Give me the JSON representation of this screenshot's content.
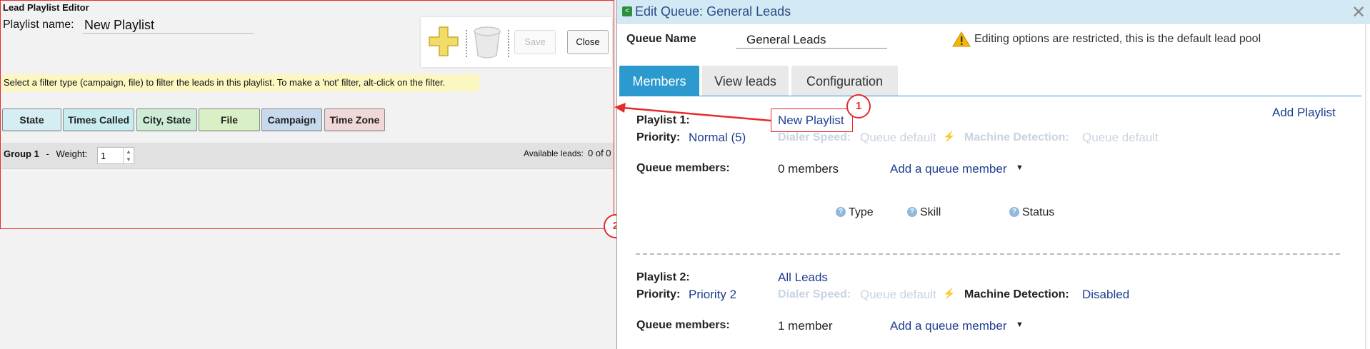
{
  "left_panel": {
    "title": "Lead Playlist Editor",
    "playlist_name_label": "Playlist name:",
    "playlist_name_value": "New Playlist",
    "toolbar": {
      "save_label": "Save",
      "close_label": "Close"
    },
    "hint": "Select a filter type (campaign, file) to filter the leads in this playlist. To make a 'not' filter, alt-click on the filter.",
    "filters": [
      {
        "label": "State",
        "color": "#d4eef3"
      },
      {
        "label": "Times Called",
        "color": "#c9ecef"
      },
      {
        "label": "City, State",
        "color": "#cdebd5"
      },
      {
        "label": "File",
        "color": "#d9efc6"
      },
      {
        "label": "Campaign",
        "color": "#c7d9ec"
      },
      {
        "label": "Time Zone",
        "color": "#f0d8d8"
      }
    ],
    "group_label": "Group 1",
    "group_separator": "-",
    "weight_label": "Weight:",
    "weight_value": "1",
    "available_label": "Available leads:",
    "available_count": "0 of 0"
  },
  "right_panel": {
    "title": "Edit Queue: General Leads",
    "queue_name_label": "Queue Name",
    "queue_name_value": "General Leads",
    "warning": "Editing options are restricted, this is the default lead pool",
    "tabs": [
      {
        "label": "Members",
        "active": true
      },
      {
        "label": "View leads",
        "active": false
      },
      {
        "label": "Configuration",
        "active": false
      }
    ],
    "add_playlist": "Add Playlist",
    "playlist1": {
      "label": "Playlist 1:",
      "name": "New Playlist",
      "priority_label": "Priority:",
      "priority_value": "Normal (5)",
      "dialer_speed_label": "Dialer Speed:",
      "dialer_speed_value": "Queue default",
      "machine_detection_label": "Machine Detection:",
      "machine_detection_value": "Queue default",
      "members_label": "Queue members:",
      "members_value": "0 members",
      "add_member": "Add a queue member",
      "columns": [
        "Type",
        "Skill",
        "Status"
      ]
    },
    "playlist2": {
      "label": "Playlist 2:",
      "name": "All Leads",
      "priority_label": "Priority:",
      "priority_value": "Priority 2",
      "dialer_speed_label": "Dialer Speed:",
      "dialer_speed_value": "Queue default",
      "machine_detection_label": "Machine Detection:",
      "machine_detection_value": "Disabled",
      "members_label": "Queue members:",
      "members_value": "1 member",
      "add_member": "Add a queue member"
    }
  },
  "annotations": {
    "marker1": "1",
    "marker2": "2",
    "accent": "#e52b2b"
  }
}
